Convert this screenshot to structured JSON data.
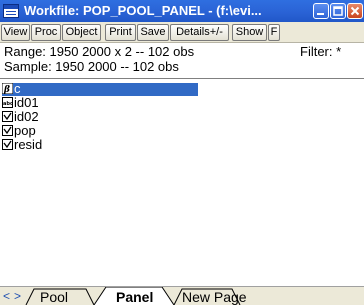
{
  "window": {
    "title": "Workfile: POP_POOL_PANEL - (f:\\evi..."
  },
  "toolbar": {
    "buttons": [
      "View",
      "Proc",
      "Object",
      "Print",
      "Save",
      "Details+/-",
      "Show",
      "F"
    ]
  },
  "info": {
    "range": "Range:  1950 2000 x 2   --  102 obs",
    "filter": "Filter: *",
    "sample": "Sample: 1950 2000   --  102 obs"
  },
  "objects": [
    {
      "name": "c",
      "icon": "coefficient-icon",
      "selected": true
    },
    {
      "name": "id01",
      "icon": "alpha-series-icon",
      "selected": false
    },
    {
      "name": "id02",
      "icon": "series-icon",
      "selected": false
    },
    {
      "name": "pop",
      "icon": "series-icon",
      "selected": false
    },
    {
      "name": "resid",
      "icon": "series-icon",
      "selected": false
    }
  ],
  "tabs": {
    "items": [
      "Pool",
      "Panel",
      "New Page"
    ],
    "active": "Panel",
    "nav": [
      "<",
      ">"
    ]
  },
  "colors": {
    "titlebar": "#2a63d6",
    "selection": "#316ac5",
    "toolbar_bg": "#ece9d8"
  }
}
